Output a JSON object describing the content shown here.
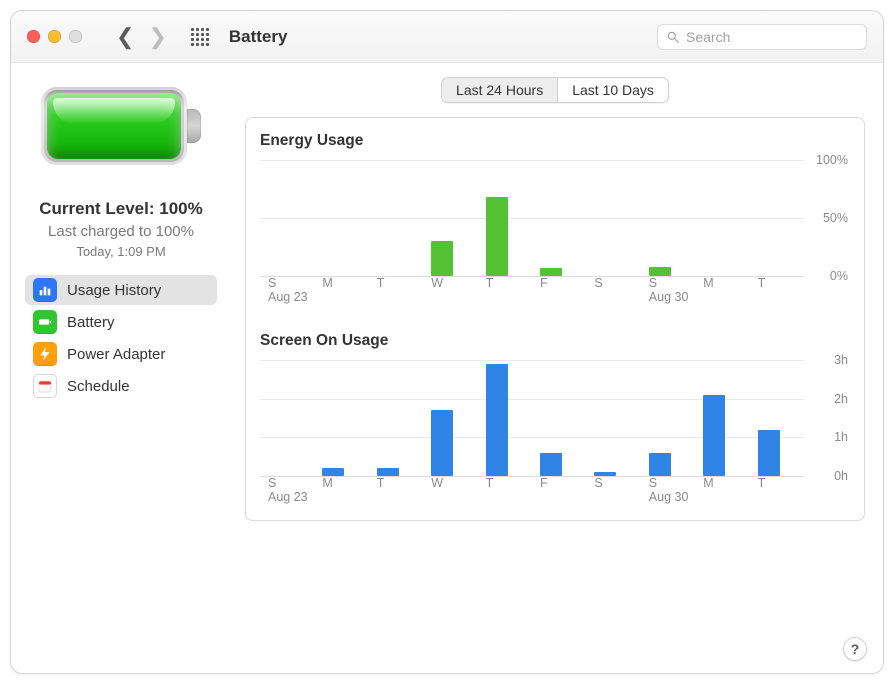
{
  "window": {
    "title": "Battery"
  },
  "search": {
    "placeholder": "Search"
  },
  "sidebar": {
    "battery_pct": 100,
    "level_line": "Current Level: 100%",
    "charged_line": "Last charged to 100%",
    "time_line": "Today, 1:09 PM",
    "items": [
      {
        "id": "usage-history",
        "label": "Usage History",
        "selected": true,
        "bg": "#2d76f6",
        "icon": "bars"
      },
      {
        "id": "battery",
        "label": "Battery",
        "selected": false,
        "bg": "#34c534",
        "icon": "battery"
      },
      {
        "id": "power-adapter",
        "label": "Power Adapter",
        "selected": false,
        "bg": "#ff9f0a",
        "icon": "bolt"
      },
      {
        "id": "schedule",
        "label": "Schedule",
        "selected": false,
        "bg": "#ffffff",
        "icon": "calendar"
      }
    ]
  },
  "segmented": {
    "options": [
      "Last 24 Hours",
      "Last 10 Days"
    ],
    "active": 0
  },
  "chart_labels": {
    "energy_title": "Energy Usage",
    "screen_title": "Screen On Usage"
  },
  "chart_data": [
    {
      "id": "energy",
      "type": "bar",
      "title": "Energy Usage",
      "categories": [
        "S",
        "M",
        "T",
        "W",
        "T",
        "F",
        "S",
        "S",
        "M",
        "T"
      ],
      "date_labels": {
        "0": "Aug 23",
        "7": "Aug 30"
      },
      "values_pct": [
        0,
        0,
        0,
        30,
        68,
        7,
        0,
        8,
        0,
        0
      ],
      "ylabel": "",
      "ylim": [
        0,
        100
      ],
      "yticks": [
        0,
        50,
        100
      ],
      "ytick_labels": [
        "0%",
        "50%",
        "100%"
      ],
      "color": "#54c232"
    },
    {
      "id": "screen",
      "type": "bar",
      "title": "Screen On Usage",
      "categories": [
        "S",
        "M",
        "T",
        "W",
        "T",
        "F",
        "S",
        "S",
        "M",
        "T"
      ],
      "date_labels": {
        "0": "Aug 23",
        "7": "Aug 30"
      },
      "values_hours": [
        0,
        0.2,
        0.2,
        1.7,
        2.9,
        0.6,
        0.1,
        0.6,
        2.1,
        1.2
      ],
      "ylabel": "",
      "ylim": [
        0,
        3
      ],
      "yticks": [
        0,
        1,
        2,
        3
      ],
      "ytick_labels": [
        "0h",
        "1h",
        "2h",
        "3h"
      ],
      "color": "#2f84e6"
    }
  ],
  "help": {
    "label": "?"
  }
}
